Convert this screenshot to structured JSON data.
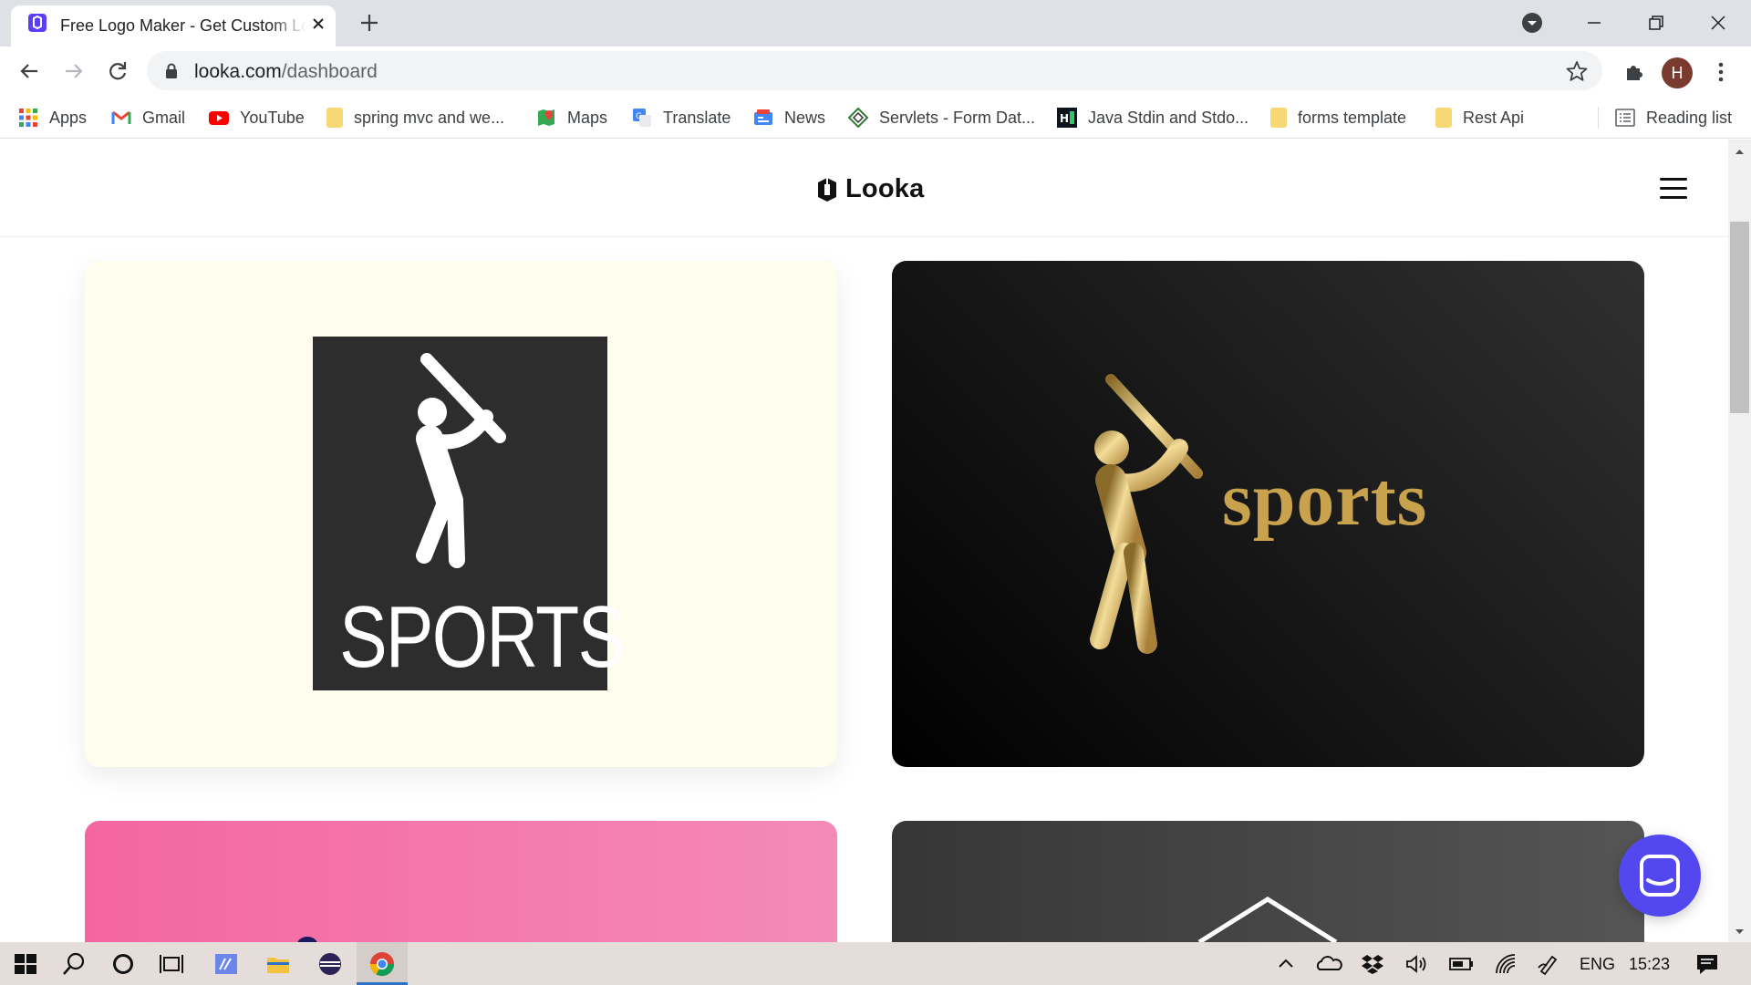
{
  "browser": {
    "tab_title": "Free Logo Maker - Get Custom Logo Designs",
    "url_domain": "looka.com",
    "url_path": "/dashboard",
    "avatar_letter": "H"
  },
  "bookmarks": [
    {
      "label": "Apps"
    },
    {
      "label": "Gmail"
    },
    {
      "label": "YouTube"
    },
    {
      "label": "spring mvc and we..."
    },
    {
      "label": "Maps"
    },
    {
      "label": "Translate"
    },
    {
      "label": "News"
    },
    {
      "label": "Servlets - Form Dat..."
    },
    {
      "label": "Java Stdin and Stdo..."
    },
    {
      "label": "forms template"
    },
    {
      "label": "Rest Api"
    },
    {
      "label": "Reading list"
    }
  ],
  "page": {
    "brand": "Looka",
    "cards": [
      {
        "text": "SPORTS",
        "background": "#fffdee"
      },
      {
        "text": "sports",
        "background": "#000000"
      },
      {
        "text": "",
        "background": "#f466a0"
      },
      {
        "text": "",
        "background": "#363636"
      }
    ]
  },
  "taskbar": {
    "language": "ENG",
    "time": "15:23"
  },
  "colors": {
    "accent": "#5348ef",
    "gold": "#c9a24e"
  }
}
